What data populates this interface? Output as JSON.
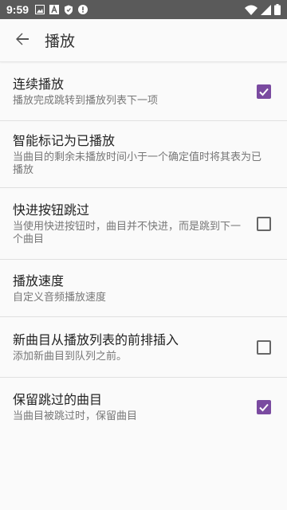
{
  "status_bar": {
    "time": "9:59",
    "left_icons": [
      "image-icon",
      "text-a-icon",
      "shield-icon",
      "alert-icon"
    ],
    "right_icons": [
      "wifi-icon",
      "signal-icon",
      "battery-icon"
    ]
  },
  "app_bar": {
    "title": "播放"
  },
  "preferences": [
    {
      "title": "连续播放",
      "summary": "播放完成跳转到播放列表下一项",
      "checkbox": true
    },
    {
      "title": "智能标记为已播放",
      "summary": "当曲目的剩余未播放时间小于一个确定值时将其表为已播放",
      "checkbox": null
    },
    {
      "title": "快进按钮跳过",
      "summary": "当使用快进按钮时，曲目并不快进，而是跳到下一个曲目",
      "checkbox": false
    },
    {
      "title": "播放速度",
      "summary": "自定义音频播放速度",
      "checkbox": null
    },
    {
      "title": "新曲目从播放列表的前排插入",
      "summary": "添加新曲目到队列之前。",
      "checkbox": false
    },
    {
      "title": "保留跳过的曲目",
      "summary": "当曲目被跳过时，保留曲目",
      "checkbox": true
    }
  ],
  "colors": {
    "accent": "#7a4aa0",
    "status_bar": "#5a5a5a",
    "background": "#fafafa"
  }
}
